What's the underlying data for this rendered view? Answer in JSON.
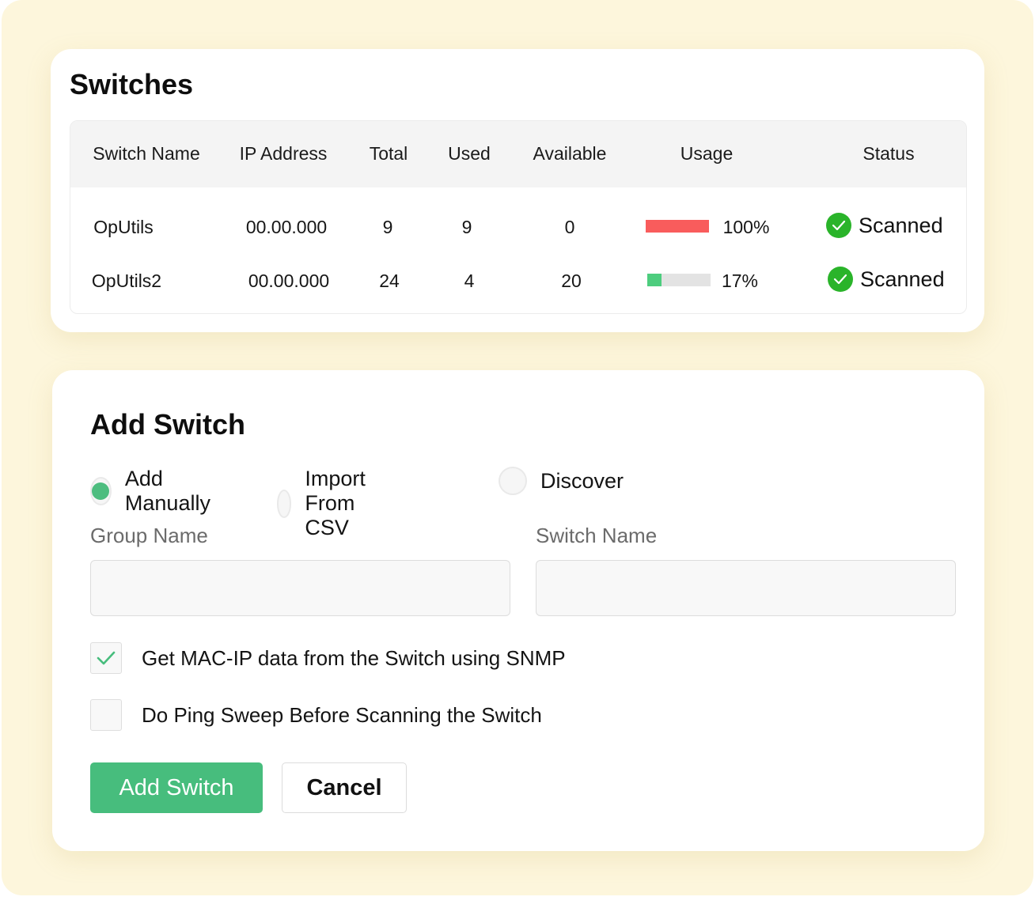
{
  "switches": {
    "title": "Switches",
    "columns": {
      "name": "Switch Name",
      "ip": "IP Address",
      "total": "Total",
      "used": "Used",
      "available": "Available",
      "usage": "Usage",
      "status": "Status"
    },
    "rows": [
      {
        "name": "OpUtils",
        "ip": "00.00.000",
        "total": "9",
        "used": "9",
        "available": "0",
        "usage_label": "100%",
        "usage_value": 1.0,
        "usage_color": "#f95c5c",
        "status": "Scanned",
        "status_icon": "check-circle-icon"
      },
      {
        "name": "OpUtils2",
        "ip": "00.00.000",
        "total": "24",
        "used": "4",
        "available": "20",
        "usage_label": "17%",
        "usage_value": 0.22,
        "usage_color": "#4dcd7e",
        "status": "Scanned",
        "status_icon": "check-circle-icon"
      }
    ]
  },
  "add_switch": {
    "title": "Add Switch",
    "methods": [
      {
        "label": "Add Manually",
        "selected": true
      },
      {
        "label": "Import From CSV",
        "selected": false
      },
      {
        "label": "Discover",
        "selected": false
      }
    ],
    "group_name_label": "Group Name",
    "group_name_value": "",
    "switch_name_label": "Switch Name",
    "switch_name_value": "",
    "options": [
      {
        "label": "Get MAC-IP data from the Switch using SNMP",
        "checked": true
      },
      {
        "label": "Do Ping Sweep Before Scanning the Switch",
        "checked": false
      }
    ],
    "submit_label": "Add Switch",
    "cancel_label": "Cancel"
  },
  "colors": {
    "accent": "#47bd7d",
    "status_ok": "#2ab42a",
    "background": "#fdf6dc"
  }
}
